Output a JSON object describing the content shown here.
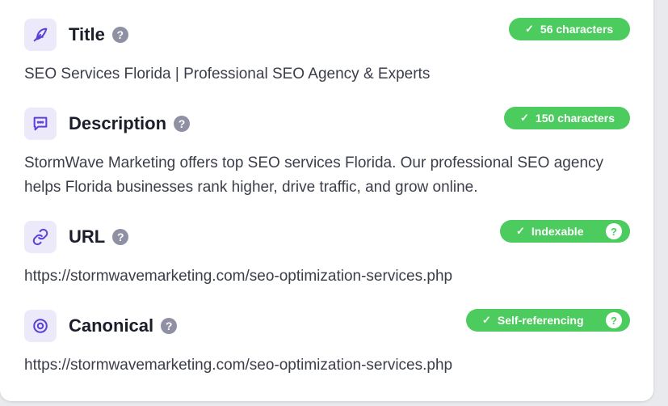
{
  "colors": {
    "accent": "#5b3fd8",
    "icon_bg": "#ece9fb",
    "badge_green": "#4ccc5e",
    "help_gray": "#8f90a3"
  },
  "sections": [
    {
      "label": "Title",
      "icon": "feather-icon",
      "help": "?",
      "badge": {
        "check": "✓",
        "text": "56 characters",
        "help": ""
      },
      "value": "SEO Services Florida | Professional SEO Agency & Experts"
    },
    {
      "label": "Description",
      "icon": "message-icon",
      "help": "?",
      "badge": {
        "check": "✓",
        "text": "150 characters",
        "help": ""
      },
      "value": "StormWave Marketing offers top SEO services Florida. Our professional SEO agency helps Florida businesses rank higher, drive traffic, and grow online."
    },
    {
      "label": "URL",
      "icon": "link-icon",
      "help": "?",
      "badge": {
        "check": "✓",
        "text": "Indexable",
        "help": "?"
      },
      "value": "https://stormwavemarketing.com/seo-optimization-services.php"
    },
    {
      "label": "Canonical",
      "icon": "target-icon",
      "help": "?",
      "badge": {
        "check": "✓",
        "text": "Self-referencing",
        "help": "?"
      },
      "value": "https://stormwavemarketing.com/seo-optimization-services.php"
    }
  ]
}
